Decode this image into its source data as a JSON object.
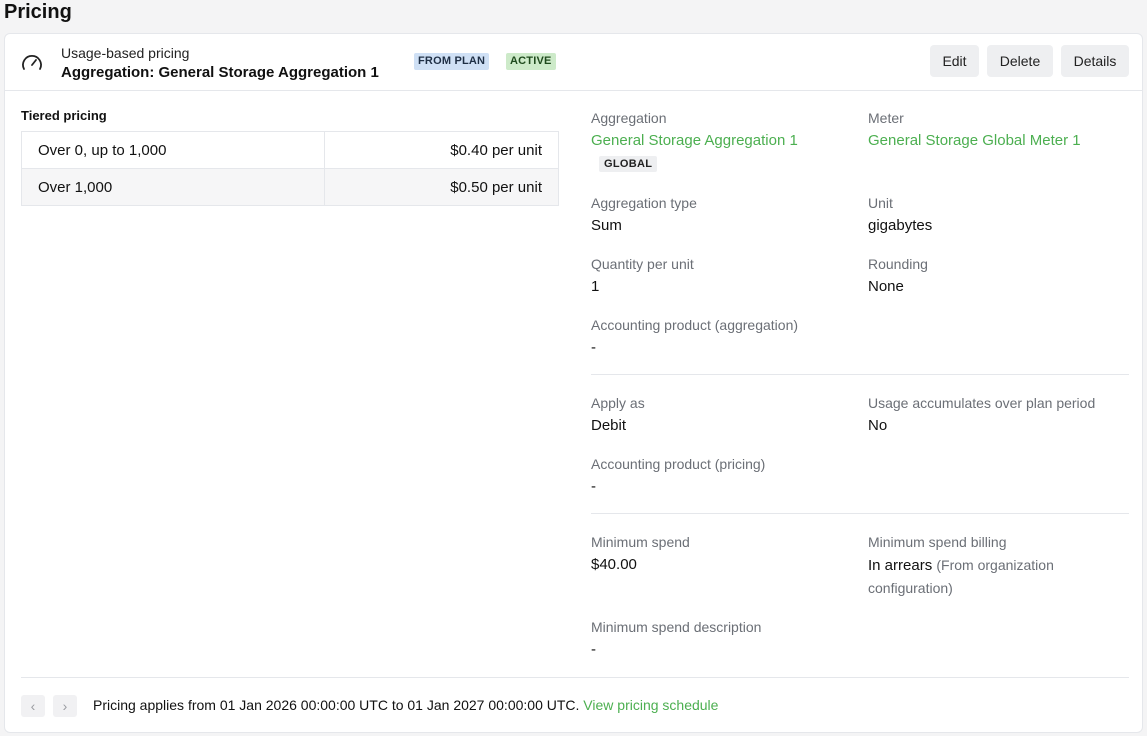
{
  "page": {
    "title": "Pricing"
  },
  "header": {
    "subtitle": "Usage-based pricing",
    "title": "Aggregation: General Storage Aggregation 1",
    "badges": {
      "plan": "FROM PLAN",
      "active": "ACTIVE"
    },
    "buttons": {
      "edit": "Edit",
      "delete": "Delete",
      "details": "Details"
    }
  },
  "tiered": {
    "label": "Tiered pricing",
    "rows": [
      {
        "range": "Over 0, up to 1,000",
        "price": "$0.40 per unit"
      },
      {
        "range": "Over 1,000",
        "price": "$0.50 per unit"
      }
    ]
  },
  "details": {
    "aggregation": {
      "label": "Aggregation",
      "value": "General Storage Aggregation 1",
      "badge": "GLOBAL"
    },
    "meter": {
      "label": "Meter",
      "value": "General Storage Global Meter 1"
    },
    "aggregation_type": {
      "label": "Aggregation type",
      "value": "Sum"
    },
    "unit": {
      "label": "Unit",
      "value": "gigabytes"
    },
    "quantity_per_unit": {
      "label": "Quantity per unit",
      "value": "1"
    },
    "rounding": {
      "label": "Rounding",
      "value": "None"
    },
    "accounting_product_aggregation": {
      "label": "Accounting product (aggregation)",
      "value": "-"
    },
    "apply_as": {
      "label": "Apply as",
      "value": "Debit"
    },
    "usage_accumulates": {
      "label": "Usage accumulates over plan period",
      "value": "No"
    },
    "accounting_product_pricing": {
      "label": "Accounting product (pricing)",
      "value": "-"
    },
    "minimum_spend": {
      "label": "Minimum spend",
      "value": "$40.00"
    },
    "minimum_spend_billing": {
      "label": "Minimum spend billing",
      "value": "In arrears",
      "note": "(From organization configuration)"
    },
    "minimum_spend_description": {
      "label": "Minimum spend description",
      "value": "-"
    }
  },
  "footer": {
    "text": "Pricing applies from 01 Jan 2026 00:00:00 UTC to 01 Jan 2027 00:00:00 UTC.",
    "link": "View pricing schedule",
    "prev_icon": "chevron-left-icon",
    "next_icon": "chevron-right-icon"
  },
  "colors": {
    "link": "#4caf50",
    "badge_plan": "#cfe0f5",
    "badge_active": "#cdeac9"
  }
}
